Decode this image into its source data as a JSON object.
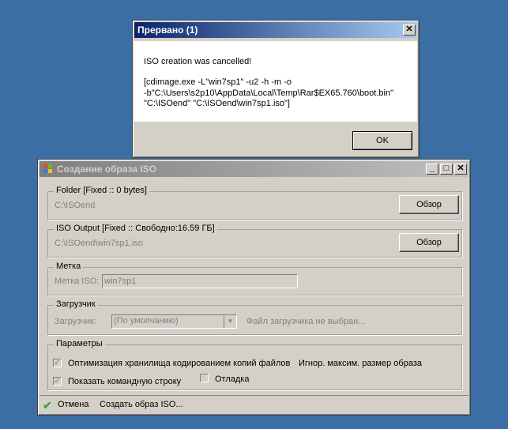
{
  "dialog": {
    "title": "Прервано (1)",
    "message": "ISO creation was cancelled!",
    "command_line1": "[cdimage.exe -L\"win7sp1\" -u2 -h -m -o",
    "command_line2": "-b\"C:\\Users\\s2p10\\AppData\\Local\\Temp\\Rar$EX65.760\\boot.bin\"",
    "command_line3": "\"C:\\ISOend\" \"C:\\ISOend\\win7sp1.iso\"]",
    "ok_label": "OK",
    "close_glyph": "✕"
  },
  "main": {
    "title": "Создание образа ISO",
    "folder": {
      "legend": "Folder [Fixed :: 0 bytes]",
      "path": "C:\\ISOend",
      "browse_label": "Обзор"
    },
    "iso_output": {
      "legend": "ISO Output [Fixed :: Свободно:16.59 ГБ]",
      "path": "C:\\ISOend\\win7sp1.iso",
      "browse_label": "Обзор"
    },
    "label_group": {
      "legend": "Метка",
      "field_label": "Метка ISO:",
      "value": "win7sp1"
    },
    "boot_group": {
      "legend": "Загрузчик",
      "field_label": "Загрузчик:",
      "select_value": "(По умолчанию)",
      "status": "Файл загрузчика не выбран..."
    },
    "params": {
      "legend": "Параметры",
      "opt1": "Оптимизация хранилища кодированием копий файлов",
      "opt2": "Игнор. максим. размер образа",
      "opt3": "Показать командную строку",
      "opt4": "Отладка"
    },
    "footer": {
      "cancel_label": "Отмена",
      "create_label": "Создать образ ISO..."
    }
  },
  "colors": {
    "desktop": "#3a6ea5",
    "title_active": "#0a246a",
    "title_inactive": "#808080"
  },
  "icons": [
    "close-icon",
    "minimize-icon",
    "maximize-icon",
    "windows-logo-icon",
    "checkmark-icon",
    "dropdown-arrow-icon"
  ]
}
